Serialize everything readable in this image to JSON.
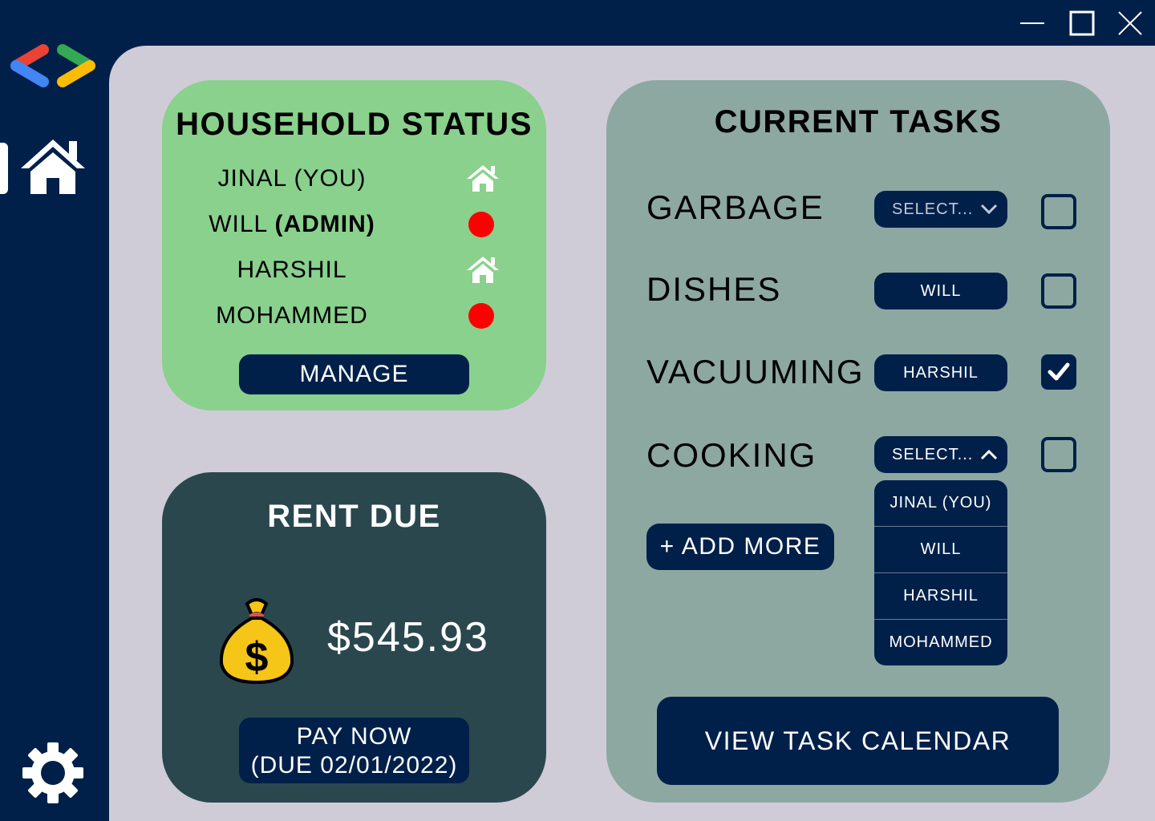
{
  "window": {
    "controls": [
      "minimize-icon",
      "maximize-icon",
      "close-icon"
    ]
  },
  "sidebar": {
    "logo": "app-logo-icon",
    "items": [
      {
        "icon": "home-icon",
        "active": true
      },
      {
        "icon": "gear-icon",
        "active": false
      }
    ]
  },
  "household": {
    "title": "HOUSEHOLD STATUS",
    "members": [
      {
        "name": "JINAL (YOU)",
        "role": "",
        "status": "home"
      },
      {
        "name": "WILL ",
        "role": "(ADMIN)",
        "status": "away"
      },
      {
        "name": "HARSHIL",
        "role": "",
        "status": "home"
      },
      {
        "name": "MOHAMMED",
        "role": "",
        "status": "away"
      }
    ],
    "manage_label": "MANAGE"
  },
  "rent": {
    "title": "RENT DUE",
    "amount": "$545.93",
    "pay_label": "PAY NOW",
    "due_label": "(DUE 02/01/2022)",
    "icon": "money-bag-icon"
  },
  "tasks": {
    "title": "CURRENT TASKS",
    "items": [
      {
        "name": "GARBAGE",
        "assignee": "SELECT...",
        "unassigned": true,
        "checked": false
      },
      {
        "name": "DISHES",
        "assignee": "WILL",
        "unassigned": false,
        "checked": false
      },
      {
        "name": "VACUUMING",
        "assignee": "HARSHIL",
        "unassigned": false,
        "checked": true
      },
      {
        "name": "COOKING",
        "assignee": "SELECT...",
        "unassigned": true,
        "checked": false
      }
    ],
    "dropdown_options": [
      "JINAL (YOU)",
      "WILL",
      "HARSHIL",
      "MOHAMMED"
    ],
    "add_more_label": "+ ADD MORE",
    "calendar_label": "VIEW TASK CALENDAR"
  },
  "colors": {
    "navy": "#00204a",
    "background": "#cfccd8",
    "household_card": "#89d18d",
    "rent_card": "#2a474e",
    "tasks_card": "#8da8a1",
    "away_dot": "#ff0000"
  }
}
